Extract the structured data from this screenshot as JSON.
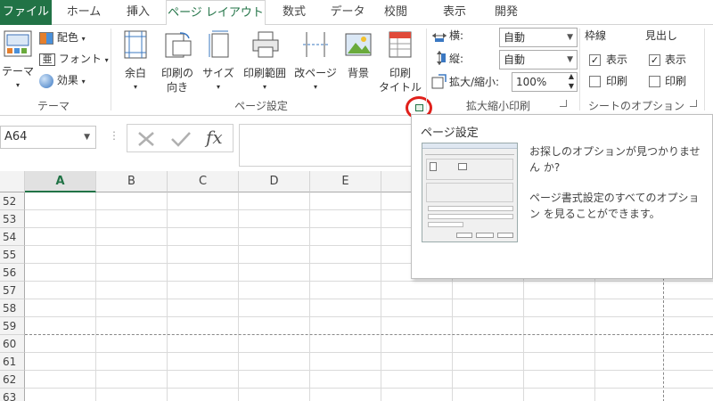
{
  "tabs": [
    "ファイル",
    "ホーム",
    "挿入",
    "ページ レイアウト",
    "数式",
    "データ",
    "校閲",
    "表示",
    "開発"
  ],
  "theme_group": {
    "label": "テーマ",
    "theme_button": "テーマ",
    "colors": "配色",
    "fonts": "フォント",
    "effects": "効果"
  },
  "page_setup_group": {
    "label": "ページ設定",
    "margins": "余白",
    "orientation_line1": "印刷の",
    "orientation_line2": "向き",
    "size": "サイズ",
    "print_area": "印刷範囲",
    "breaks": "改ページ",
    "background": "背景",
    "print_titles_line1": "印刷",
    "print_titles_line2": "タイトル"
  },
  "scale_group": {
    "label": "拡大縮小印刷",
    "width_label": "横:",
    "width_value": "自動",
    "height_label": "縦:",
    "height_value": "自動",
    "scale_label": "拡大/縮小:",
    "scale_value": "100%"
  },
  "sheet_options_group": {
    "label": "シートのオプション",
    "gridlines": "枠線",
    "headings": "見出し",
    "view": "表示",
    "print": "印刷",
    "gridlines_view_checked": true,
    "gridlines_print_checked": false,
    "headings_view_checked": true,
    "headings_print_checked": false
  },
  "formula_bar": {
    "name_box": "A64",
    "fx": "fx"
  },
  "columns": [
    "A",
    "B",
    "C",
    "D",
    "E"
  ],
  "rows": [
    "52",
    "53",
    "54",
    "55",
    "56",
    "57",
    "58",
    "59",
    "60",
    "61",
    "62",
    "63"
  ],
  "tooltip": {
    "title": "ページ設定",
    "text1": "お探しのオプションが見つかりません か?",
    "text2": "ページ書式設定のすべてのオプション を見ることができます。"
  },
  "colors": {
    "excel_green": "#217346",
    "highlight_circle": "#e0201b"
  }
}
